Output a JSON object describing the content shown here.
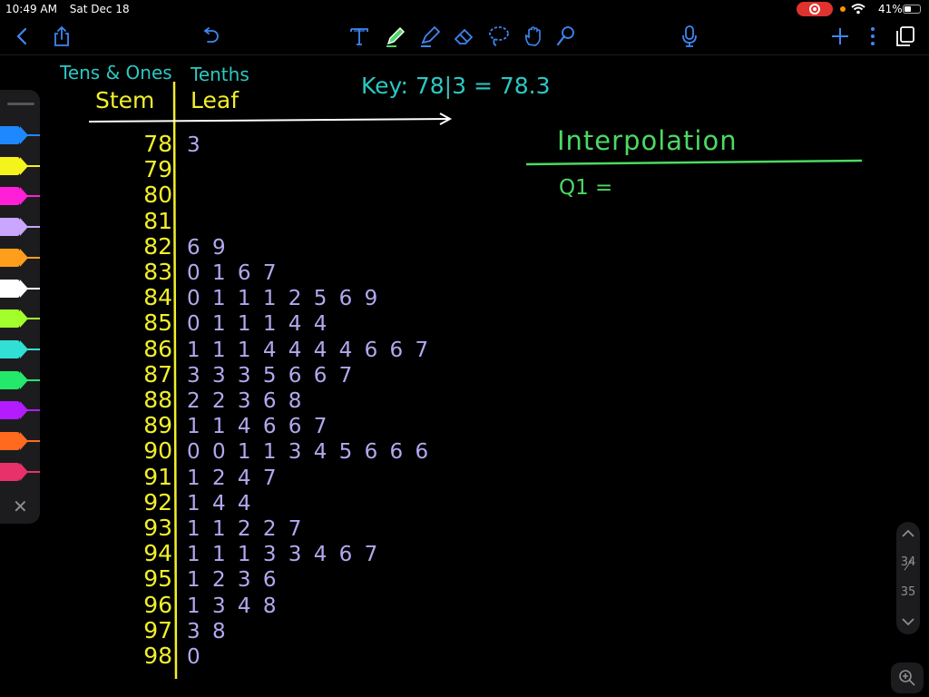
{
  "status_bar": {
    "time": "10:49 AM",
    "date": "Sat Dec 18",
    "battery": "41%"
  },
  "toolbar": {
    "left_icons": [
      "chevron-left-icon",
      "share-icon",
      "undo-icon"
    ],
    "tool_icons": [
      "text-tool-icon",
      "pen-icon",
      "highlighter-icon",
      "eraser-icon",
      "lasso-icon",
      "hand-icon",
      "shape-icon"
    ],
    "right_icons": [
      "mic-icon",
      "plus-icon",
      "more-icon",
      "pages-icon"
    ]
  },
  "pen_tray": {
    "colors": [
      "#1e88ff",
      "#f4f41c",
      "#ff1fd6",
      "#c9a6ff",
      "#ff9e1b",
      "#ffffff",
      "#a2ff2b",
      "#31e0d4",
      "#23e86a",
      "#b21cff",
      "#ff6a1e",
      "#e8306a"
    ]
  },
  "note": {
    "stem_header_top": "Tens & Ones",
    "stem_header": "Stem",
    "leaf_header_top": "Tenths",
    "leaf_header": "Leaf",
    "key": "Key: 78|3 = 78.3",
    "interpolation_title": "Interpolation",
    "q1_label": "Q1 =",
    "rows": [
      {
        "stem": "78",
        "leaves": "3"
      },
      {
        "stem": "79",
        "leaves": ""
      },
      {
        "stem": "80",
        "leaves": ""
      },
      {
        "stem": "81",
        "leaves": ""
      },
      {
        "stem": "82",
        "leaves": "6 9"
      },
      {
        "stem": "83",
        "leaves": "0 1 6 7"
      },
      {
        "stem": "84",
        "leaves": "0 1 1 1 2 5 6 9"
      },
      {
        "stem": "85",
        "leaves": "0 1 1 1 4 4"
      },
      {
        "stem": "86",
        "leaves": "1 1 1 4 4 4 4 6 6 7"
      },
      {
        "stem": "87",
        "leaves": "3 3 3 5 6 6 7"
      },
      {
        "stem": "88",
        "leaves": "2 2 3 6 8"
      },
      {
        "stem": "89",
        "leaves": "1 1 4 6 6 7"
      },
      {
        "stem": "90",
        "leaves": "0 0 1 1 3 4 5 6 6 6"
      },
      {
        "stem": "91",
        "leaves": "1 2 4 7"
      },
      {
        "stem": "92",
        "leaves": "1 4 4"
      },
      {
        "stem": "93",
        "leaves": "1 1 2 2 7"
      },
      {
        "stem": "94",
        "leaves": "1 1 1 3 3 4 6 7"
      },
      {
        "stem": "95",
        "leaves": "1 2 3 6"
      },
      {
        "stem": "96",
        "leaves": "1 3 4 8"
      },
      {
        "stem": "97",
        "leaves": "3 8"
      },
      {
        "stem": "98",
        "leaves": "0"
      }
    ]
  },
  "page_nav": {
    "current": "34",
    "total": "35"
  }
}
